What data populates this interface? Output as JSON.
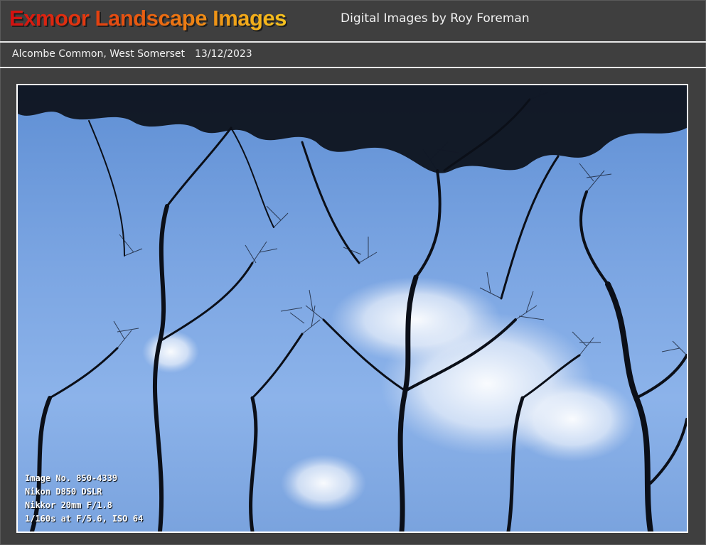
{
  "header": {
    "site_title": "Exmoor Landscape Images",
    "subtitle": "Digital Images by Roy Foreman"
  },
  "caption": {
    "location": "Alcombe Common, West Somerset",
    "date": "13/12/2023"
  },
  "photo": {
    "exif": {
      "image_no": "Image No. 850-4339",
      "camera": "Nikon D850 DSLR",
      "lens": "Nikkor 20mm F/1.8",
      "exposure": "1/160s at F/5.6,  ISO 64"
    }
  },
  "colors": {
    "background": "#3f3f3f",
    "title_gradient_start": "#d31010",
    "title_gradient_end": "#f6c21e",
    "rule": "#e8e8e8",
    "sky": "#7ba5e2"
  }
}
